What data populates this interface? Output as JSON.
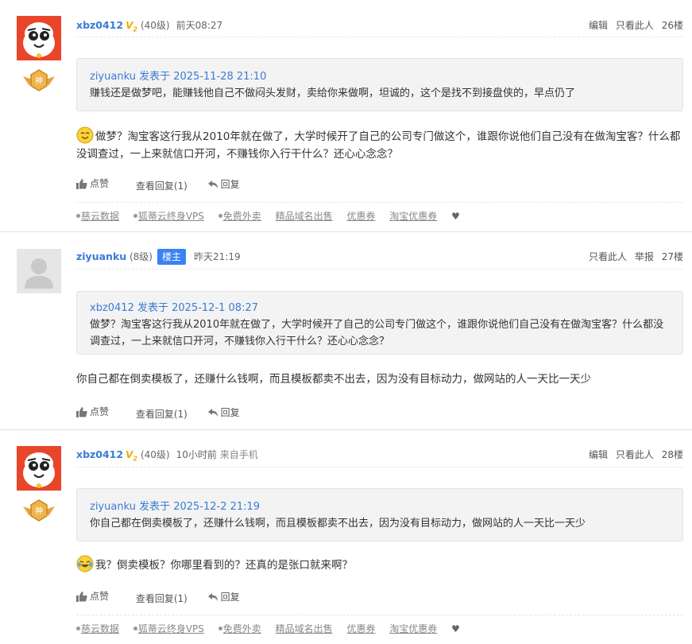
{
  "posts": [
    {
      "username": "xbz0412",
      "vip": "V",
      "vip_sub": "2",
      "level": "(40级)",
      "time": "前天08:27",
      "source": "",
      "actions_right": [
        "编辑",
        "只看此人"
      ],
      "floor": "26楼",
      "quote_header": "ziyuanku 发表于 2025-11-28 21:10",
      "quote_text": "赚钱还是做梦吧，能赚钱他自己不做闷头发财，卖给你来做啊，坦诚的，这个是找不到接盘侠的，早点仍了",
      "body": "做梦？淘宝客这行我从2010年就在做了，大学时候开了自己的公司专门做这个，谁跟你说他们自己没有在做淘宝客？什么都没调查过，一上来就信口开河，不赚钱你入行干什么？还心心念念？",
      "like_label": "点赞",
      "view_replies_label": "查看回复(1)",
      "reply_label": "回复"
    },
    {
      "username": "ziyuanku",
      "level": "(8级)",
      "badge": "楼主",
      "time": "昨天21:19",
      "actions_right": [
        "只看此人",
        "举报"
      ],
      "floor": "27楼",
      "quote_header": "xbz0412 发表于 2025-12-1 08:27",
      "quote_text": "做梦？淘宝客这行我从2010年就在做了，大学时候开了自己的公司专门做这个，谁跟你说他们自己没有在做淘宝客？什么都没调查过，一上来就信口开河，不赚钱你入行干什么？还心心念念？",
      "body": "你自己都在倒卖模板了，还赚什么钱啊，而且模板都卖不出去，因为没有目标动力，做网站的人一天比一天少",
      "like_label": "点赞",
      "view_replies_label": "查看回复(1)",
      "reply_label": "回复"
    },
    {
      "username": "xbz0412",
      "vip": "V",
      "vip_sub": "2",
      "level": "(40级)",
      "time": "10小时前",
      "source": "来自手机",
      "actions_right": [
        "编辑",
        "只看此人"
      ],
      "floor": "28楼",
      "quote_header": "ziyuanku 发表于 2025-12-2 21:19",
      "quote_text": "你自己都在倒卖模板了，还赚什么钱啊，而且模板都卖不出去，因为没有目标动力，做网站的人一天比一天少",
      "body": "我？倒卖模板？你哪里看到的？还真的是张口就来啊？",
      "like_label": "点赞",
      "view_replies_label": "查看回复(1)",
      "reply_label": "回复"
    }
  ],
  "ad_links": [
    "慈云数据",
    "狐蒂云终身VPS",
    "免费外卖",
    "精品域名出售",
    "优惠券",
    "淘宝优惠券"
  ],
  "colors": {
    "link": "#3a7bd5",
    "badge_bg": "#3b82f6",
    "vip": "#f2a900",
    "avatar_bg": "#e8452a"
  }
}
